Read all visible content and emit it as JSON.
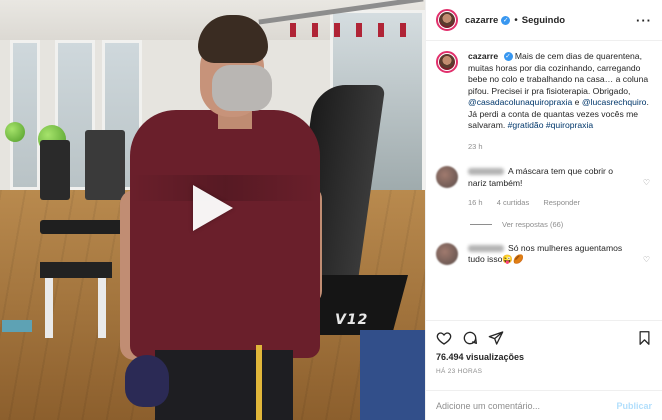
{
  "post": {
    "username": "cazarre",
    "follow_status": "Seguindo",
    "separator": "•",
    "more_icon": "more-horizontal-icon"
  },
  "caption": {
    "username": "cazarre",
    "text_1": "Mais de cem dias de quarentena, muitas horas por dia cozinhando, carregando bebe no colo e trabalhando na casa… a coluna pifou. Precisei ir pra fisioterapia. Obrigado, ",
    "mention_1": "@casadacolunaquiropraxia",
    "text_2": " e ",
    "mention_2": "@lucasrechquiro",
    "text_3": ". Já perdi a conta de quantas vezes vocês me salvaram. ",
    "hashtag_1": "#gratidão",
    "hashtag_2": "#quiropraxia",
    "time": "23 h"
  },
  "comments": [
    {
      "text": "A máscara tem que cobrir o nariz também!",
      "time": "16 h",
      "likes": "4 curtidas",
      "reply": "Responder"
    },
    {
      "text": "Só nos mulheres aguentamos tudo isso😜🏉"
    }
  ],
  "view_replies": "Ver respostas (66)",
  "stats": {
    "views": "76.494 visualizações",
    "ago": "HÁ 23 HORAS"
  },
  "add_comment": {
    "placeholder": "Adicione um comentário...",
    "publish": "Publicar"
  },
  "video": {
    "overlay_text": "V12"
  },
  "colors": {
    "link": "#00376b",
    "verified": "#3897f0",
    "publish_disabled": "#b2dffc",
    "shirt": "#6a1f2b"
  }
}
